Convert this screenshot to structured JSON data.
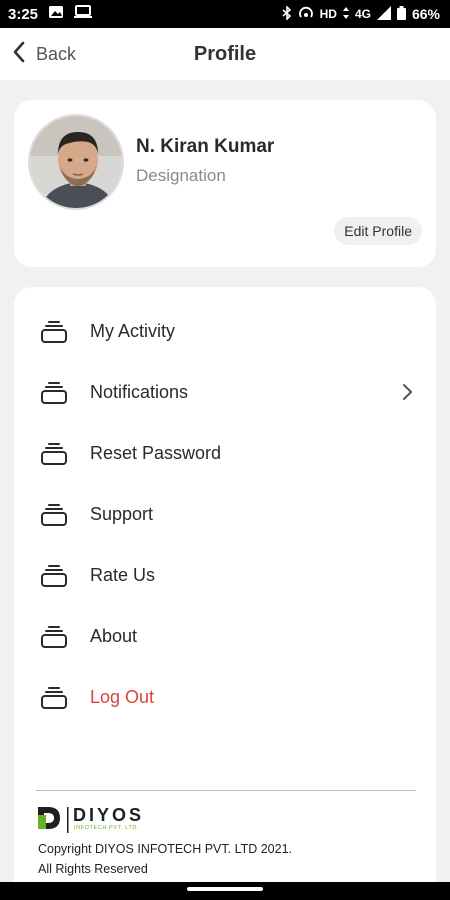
{
  "status_bar": {
    "time": "3:25",
    "network": "HD",
    "signal": "4G",
    "battery": "66%"
  },
  "header": {
    "back_label": "Back",
    "title": "Profile"
  },
  "profile": {
    "name": "N. Kiran Kumar",
    "designation": "Designation",
    "edit_label": "Edit Profile"
  },
  "menu": {
    "items": [
      {
        "label": "My Activity",
        "has_chevron": false
      },
      {
        "label": "Notifications",
        "has_chevron": true
      },
      {
        "label": "Reset Password",
        "has_chevron": false
      },
      {
        "label": "Support",
        "has_chevron": false
      },
      {
        "label": "Rate Us",
        "has_chevron": false
      },
      {
        "label": "About",
        "has_chevron": false
      },
      {
        "label": "Log Out",
        "has_chevron": false
      }
    ]
  },
  "footer": {
    "logo_text": "DIYOS",
    "logo_subtext": "INFOTECH PVT. LTD.",
    "copyright_line1": "Copyright DIYOS INFOTECH PVT. LTD 2021.",
    "copyright_line2": "All Rights Reserved"
  },
  "colors": {
    "logout": "#d9453d",
    "logo_green": "#6ab023",
    "background": "#f1f1f1"
  }
}
